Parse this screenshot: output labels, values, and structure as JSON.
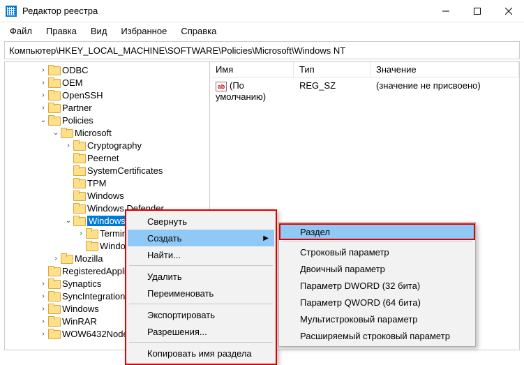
{
  "window": {
    "title": "Редактор реестра"
  },
  "menu": {
    "file": "Файл",
    "edit": "Правка",
    "view": "Вид",
    "favorites": "Избранное",
    "help": "Справка"
  },
  "address": "Компьютер\\HKEY_LOCAL_MACHINE\\SOFTWARE\\Policies\\Microsoft\\Windows NT",
  "tree": {
    "odbc": "ODBC",
    "oem": "OEM",
    "openssh": "OpenSSH",
    "partner": "Partner",
    "policies": "Policies",
    "microsoft": "Microsoft",
    "crypt": "Cryptography",
    "peernet": "Peernet",
    "syscert": "SystemCertificates",
    "tpm": "TPM",
    "windows": "Windows",
    "windef": "Windows Defender",
    "winnt": "Windows NT",
    "term": "Terminal Server",
    "wind2": "Windows Update",
    "mozilla": "Mozilla",
    "regapp": "RegisteredApplications",
    "synaptics": "Synaptics",
    "syncint": "SyncIntegration",
    "windows2": "Windows",
    "winrar": "WinRAR",
    "wow": "WOW6432Node"
  },
  "columns": {
    "name": "Имя",
    "type": "Тип",
    "value": "Значение"
  },
  "values": {
    "default_name": "(По умолчанию)",
    "default_type": "REG_SZ",
    "default_value": "(значение не присвоено)"
  },
  "context1": {
    "collapse": "Свернуть",
    "new": "Создать",
    "find": "Найти...",
    "delete": "Удалить",
    "rename": "Переименовать",
    "export": "Экспортировать",
    "permissions": "Разрешения...",
    "copykey": "Копировать имя раздела"
  },
  "context2": {
    "key": "Раздел",
    "string": "Строковый параметр",
    "binary": "Двоичный параметр",
    "dword": "Параметр DWORD (32 бита)",
    "qword": "Параметр QWORD (64 бита)",
    "multi": "Мультистроковый параметр",
    "expand": "Расширяемый строковый параметр"
  }
}
